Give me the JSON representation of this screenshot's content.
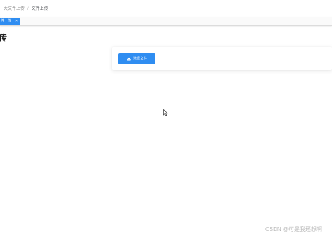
{
  "breadcrumb": {
    "root": "大文件上传",
    "separator": "/",
    "current": "文件上传"
  },
  "tags": {
    "active_label": "件上传",
    "close_glyph": "×"
  },
  "page": {
    "title": "传"
  },
  "upload": {
    "button_label": "选择文件",
    "icon": "cloud-upload-icon"
  },
  "watermark": {
    "text": "CSDN @可是我还想啊"
  },
  "colors": {
    "accent": "#2f8df1",
    "breadcrumb_text": "#8c8c8c"
  }
}
